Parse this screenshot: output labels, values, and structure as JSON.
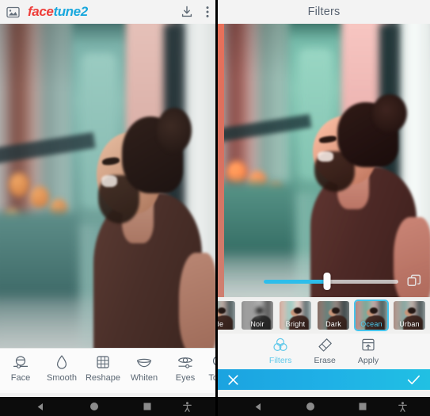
{
  "left_panel": {
    "topbar": {
      "gallery_icon": "gallery-icon",
      "brand_part1": "face",
      "brand_part2": "tune2",
      "download_icon": "download-icon",
      "menu_icon": "overflow-menu-icon"
    },
    "tools": [
      {
        "label": "Face",
        "icon": "face-slider-icon"
      },
      {
        "label": "Smooth",
        "icon": "water-drop-icon"
      },
      {
        "label": "Reshape",
        "icon": "grid-mesh-icon"
      },
      {
        "label": "Whiten",
        "icon": "teeth-smile-icon"
      },
      {
        "label": "Eyes",
        "icon": "eye-slider-icon"
      },
      {
        "label": "Touc",
        "icon": "touch-up-icon"
      }
    ]
  },
  "right_panel": {
    "header": {
      "title": "Filters"
    },
    "slider": {
      "value_percent": 47,
      "compare_icon": "compare-layers-icon"
    },
    "filters": [
      {
        "label": "de",
        "selected": false,
        "style": "fade"
      },
      {
        "label": "Noir",
        "selected": false,
        "style": "noir"
      },
      {
        "label": "Bright",
        "selected": false,
        "style": "bright"
      },
      {
        "label": "Dark",
        "selected": false,
        "style": "dark"
      },
      {
        "label": "Ocean",
        "selected": true,
        "style": "ocean"
      },
      {
        "label": "Urban",
        "selected": false,
        "style": "urban"
      }
    ],
    "tools": [
      {
        "label": "Filters",
        "icon": "filters-circles-icon",
        "active": true
      },
      {
        "label": "Erase",
        "icon": "eraser-icon",
        "active": false
      },
      {
        "label": "Apply",
        "icon": "apply-stamp-icon",
        "active": false
      }
    ],
    "confirm_bar": {
      "cancel_icon": "close-x-icon",
      "accept_icon": "checkmark-icon",
      "accent_color": "#1fb0e6"
    }
  },
  "navbar": {
    "back_icon": "back-triangle-icon",
    "home_icon": "home-circle-icon",
    "recents_icon": "recents-square-icon",
    "accessibility_icon": "accessibility-icon"
  },
  "colors": {
    "accent_cyan": "#45c4ec",
    "brand_red": "#ee3e3a",
    "brand_blue": "#19a8dd",
    "tool_gray": "#5b6773"
  }
}
